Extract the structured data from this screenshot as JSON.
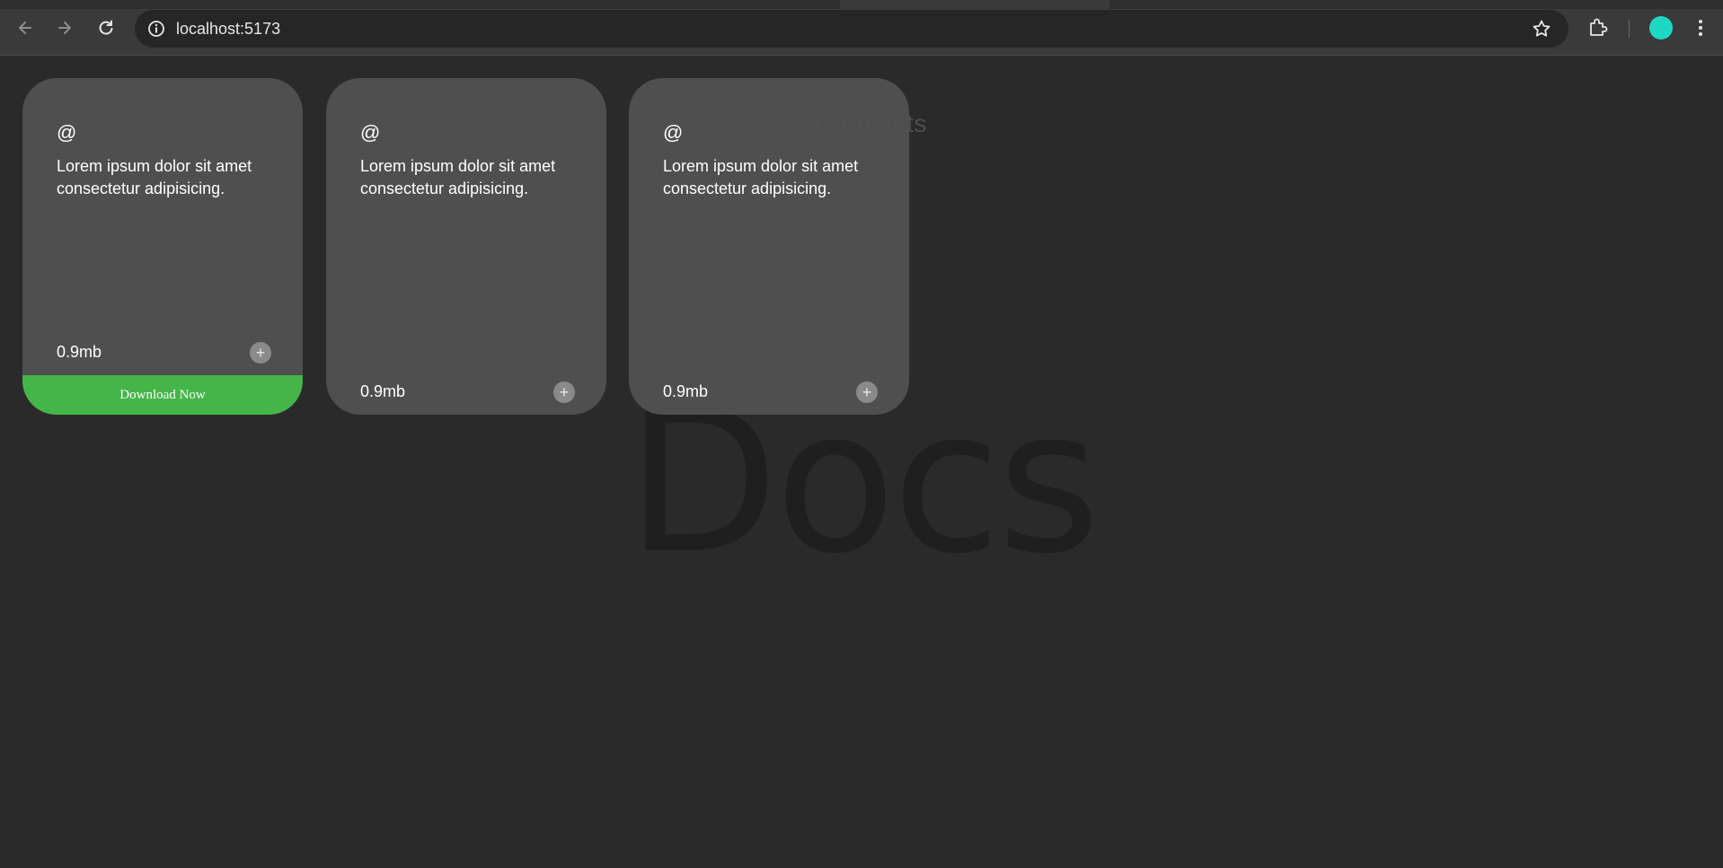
{
  "browser": {
    "url": "localhost:5173",
    "back_icon": "arrow-left-icon",
    "forward_icon": "arrow-right-icon",
    "reload_icon": "reload-icon",
    "avatar_color": "#1fd8c4"
  },
  "page": {
    "bg_title": "Documents",
    "bg_big": "Docs"
  },
  "cards": [
    {
      "icon": "@",
      "desc": "Lorem ipsum dolor sit amet consectetur adipisicing.",
      "size": "0.9mb",
      "add": "+",
      "download_label": "Download Now"
    },
    {
      "icon": "@",
      "desc": "Lorem ipsum dolor sit amet consectetur adipisicing.",
      "size": "0.9mb",
      "add": "+"
    },
    {
      "icon": "@",
      "desc": "Lorem ipsum dolor sit amet consectetur adipisicing.",
      "size": "0.9mb",
      "add": "+"
    }
  ],
  "colors": {
    "download_bar": "#45b549",
    "card_bg": "#525252",
    "page_bg": "#2a2a2a"
  }
}
